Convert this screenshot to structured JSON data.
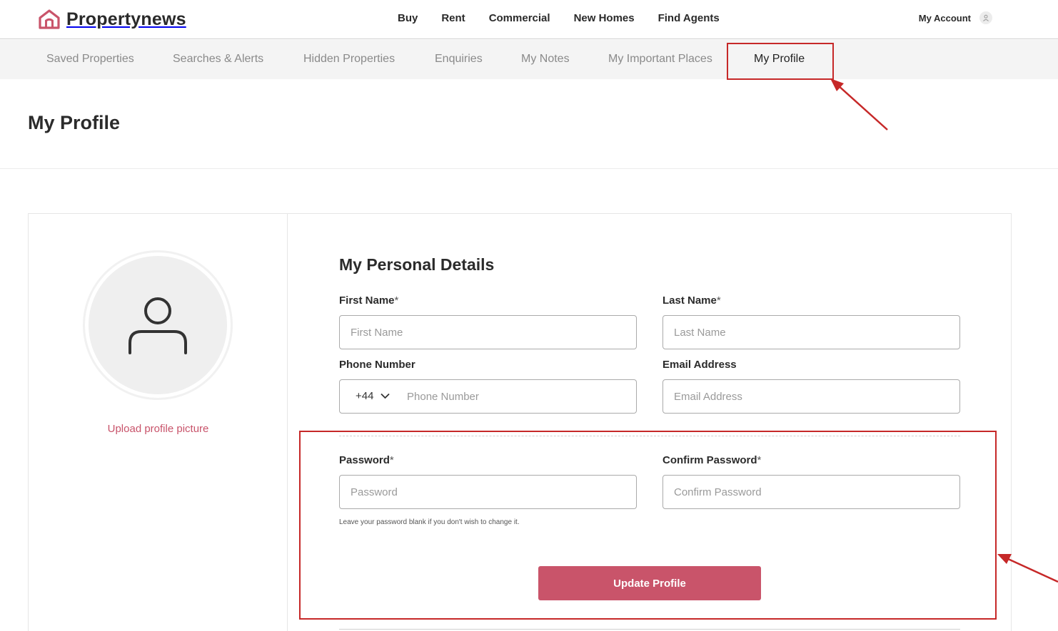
{
  "header": {
    "brand": "Propertynews",
    "nav": [
      "Buy",
      "Rent",
      "Commercial",
      "New Homes",
      "Find Agents"
    ],
    "account_label": "My Account"
  },
  "subnav": {
    "items": [
      "Saved Properties",
      "Searches & Alerts",
      "Hidden Properties",
      "Enquiries",
      "My Notes",
      "My Important Places",
      "My Profile"
    ],
    "active": "My Profile"
  },
  "page": {
    "title": "My Profile"
  },
  "profile": {
    "upload_label": "Upload profile picture"
  },
  "form": {
    "title": "My Personal Details",
    "first_name": {
      "label": "First Name",
      "required": "*",
      "placeholder": "First Name",
      "value": ""
    },
    "last_name": {
      "label": "Last Name",
      "required": "*",
      "placeholder": "Last Name",
      "value": ""
    },
    "phone": {
      "label": "Phone Number",
      "country_code": "+44",
      "placeholder": "Phone Number",
      "value": ""
    },
    "email": {
      "label": "Email Address",
      "placeholder": "Email Address",
      "value": ""
    },
    "password": {
      "label": "Password",
      "required": "*",
      "placeholder": "Password",
      "value": ""
    },
    "confirm_password": {
      "label": "Confirm Password",
      "required": "*",
      "placeholder": "Confirm Password",
      "value": ""
    },
    "hint": "Leave your password blank if you don't wish to change it.",
    "submit_label": "Update Profile"
  },
  "colors": {
    "brand": "#c9546a",
    "annotation": "#c62828"
  },
  "icons": {
    "logo": "house-icon",
    "account": "user-icon",
    "avatar": "user-icon",
    "country_select": "chevron-down-icon"
  }
}
